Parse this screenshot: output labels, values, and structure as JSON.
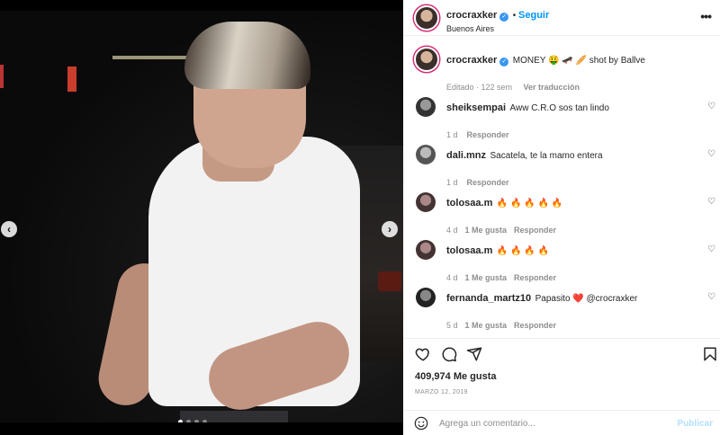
{
  "header": {
    "username": "crocraxker",
    "follow_label": "Seguir",
    "location": "Buenos Aires",
    "more": "•••"
  },
  "caption": {
    "username": "crocraxker",
    "text": "MONEY 🤑 🛹 🥖 shot by Ballve",
    "edited": "Editado",
    "time": "122 sem",
    "translate": "Ver traducción"
  },
  "comments": [
    {
      "username": "sheiksempai",
      "text": "Aww C.R.O sos tan lindo",
      "time": "1 d",
      "likes_label": "",
      "reply": "Responder"
    },
    {
      "username": "dali.mnz",
      "text": "Sacatela, te la mamo entera",
      "time": "1 d",
      "likes_label": "",
      "reply": "Responder"
    },
    {
      "username": "tolosaa.m",
      "text": "🔥 🔥 🔥 🔥 🔥",
      "time": "4 d",
      "likes_label": "1 Me gusta",
      "reply": "Responder"
    },
    {
      "username": "tolosaa.m",
      "text": "🔥 🔥 🔥 🔥",
      "time": "4 d",
      "likes_label": "1 Me gusta",
      "reply": "Responder"
    },
    {
      "username": "fernanda_martz10",
      "text": "Papasito ❤️ @crocraxker",
      "time": "5 d",
      "likes_label": "1 Me gusta",
      "reply": "Responder"
    }
  ],
  "post": {
    "likes": "409,974 Me gusta",
    "date": "MARZO 12, 2019"
  },
  "composer": {
    "placeholder": "Agrega un comentario...",
    "post_label": "Publicar"
  },
  "carousel": {
    "count": 4,
    "active": 1
  },
  "colors": {
    "accent": "#0095f6",
    "verified": "#3897f0",
    "heart": "#ed1c3b",
    "flame": "#f58220"
  }
}
